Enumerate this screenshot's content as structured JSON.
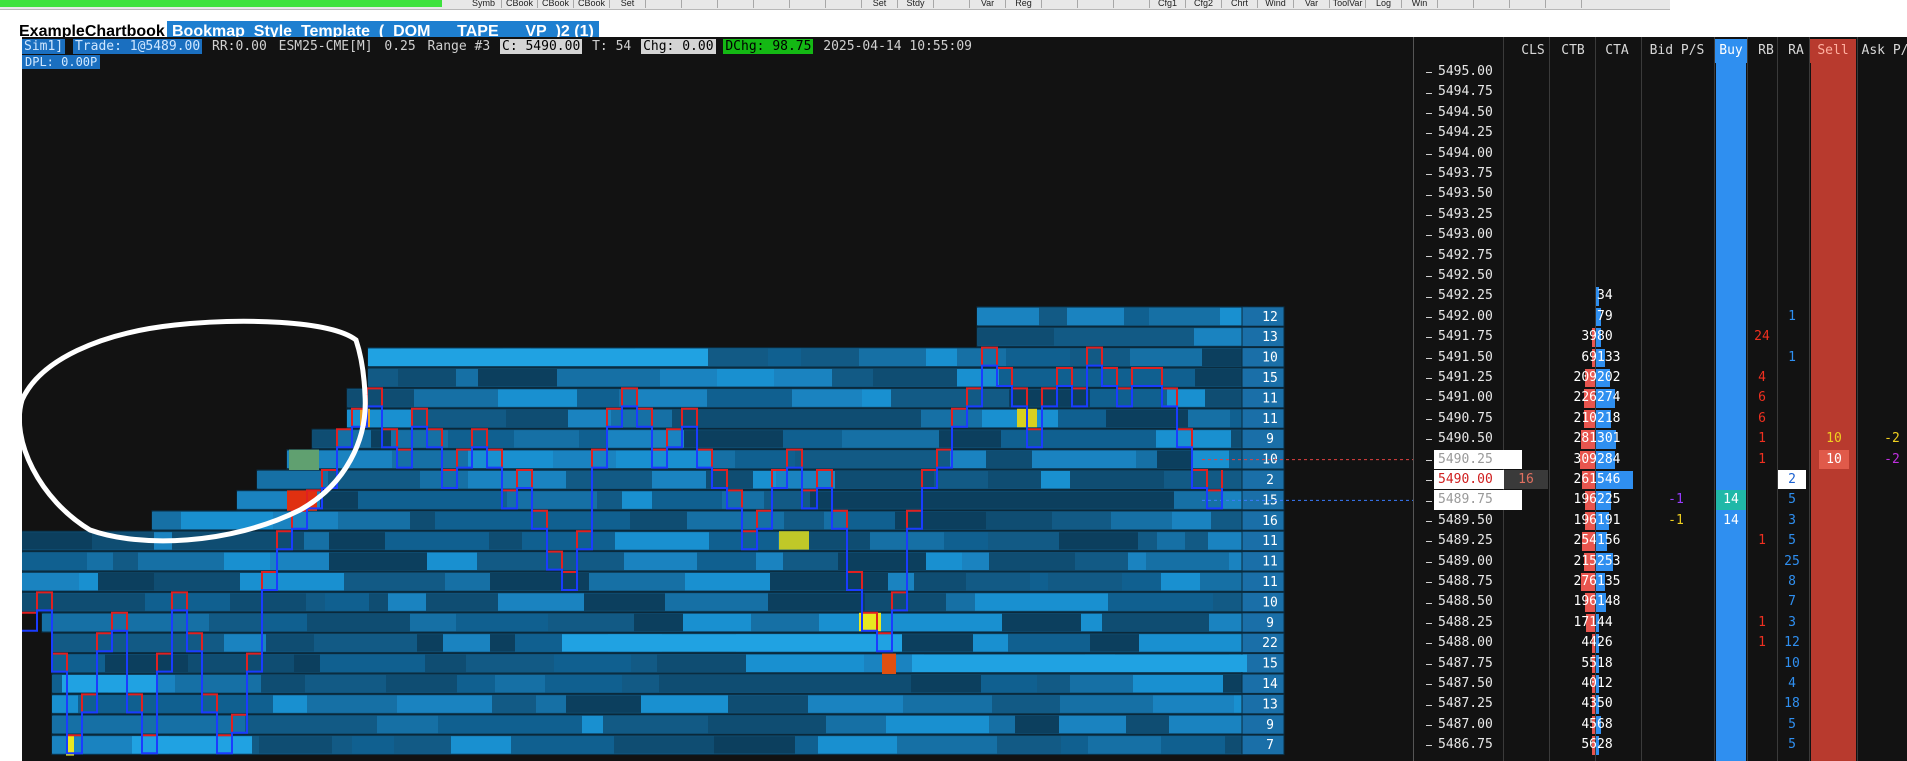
{
  "toolbar": {
    "buttons": [
      "Symb",
      "CBook",
      "CBook",
      "CBook",
      "Set",
      "",
      "",
      "",
      "",
      "",
      "",
      "Set",
      "Stdy",
      "",
      "Var",
      "Reg",
      "",
      "",
      "",
      "Cfg1",
      "Cfg2",
      "Chrt",
      "Wind",
      "Var",
      "ToolVar",
      "Log",
      "Win",
      "",
      "",
      "",
      ""
    ]
  },
  "tabs": [
    {
      "label": "ExampleChartbook"
    },
    {
      "label": "Bookmap_Style_Template_(_DOM___TAPE___VP_)2 (1)"
    }
  ],
  "infobar": {
    "sim": "Sim1]",
    "trade": "Trade: 1@5489.00",
    "rr": "RR:0.00",
    "symbol": "ESM25-CME[M]",
    "tick": "0.25",
    "range": "Range #3",
    "close": "C: 5490.00",
    "t": "T: 54",
    "chg": "Chg: 0.00",
    "dchg": "DChg: 98.75",
    "datetime": "2025-04-14 10:55:09",
    "dpl": "DPL: 0.00P"
  },
  "ladder": {
    "headers": {
      "cls": "CLS",
      "ctb": "CTB",
      "cta": "CTA",
      "bidps": "Bid P/S",
      "buy": "Buy",
      "rb": "RB",
      "ra": "RA",
      "sell": "Sell",
      "askps": "Ask P/"
    },
    "prices": [
      "5495.00",
      "5494.75",
      "5494.50",
      "5494.25",
      "5494.00",
      "5493.75",
      "5493.50",
      "5493.25",
      "5493.00",
      "5492.75",
      "5492.50",
      "5492.25",
      "5492.00",
      "5491.75",
      "5491.50",
      "5491.25",
      "5491.00",
      "5490.75",
      "5490.50",
      "5490.25",
      "5490.00",
      "5489.75",
      "5489.50",
      "5489.25",
      "5489.00",
      "5488.75",
      "5488.50",
      "5488.25",
      "5488.00",
      "5487.75",
      "5487.50",
      "5487.25",
      "5487.00",
      "5486.75"
    ],
    "current_price_index": 20,
    "ask_index": 19,
    "bid_index": 21,
    "cls_value": "16",
    "ctb": [
      "",
      "",
      "",
      "",
      "",
      "",
      "",
      "",
      "",
      "",
      "",
      "",
      "",
      "39",
      "69",
      "209",
      "226",
      "210",
      "281",
      "309",
      "261",
      "196",
      "196",
      "254",
      "215",
      "276",
      "196",
      "171",
      "44",
      "55",
      "40",
      "43",
      "45",
      "56"
    ],
    "cta": [
      "",
      "",
      "",
      "",
      "",
      "",
      "",
      "",
      "",
      "",
      "",
      "34",
      "79",
      "80",
      "133",
      "202",
      "274",
      "218",
      "301",
      "284",
      "546",
      "225",
      "191",
      "156",
      "253",
      "135",
      "148",
      "44",
      "26",
      "18",
      "12",
      "50",
      "68",
      "28"
    ],
    "bid_ps": [
      "",
      "",
      "",
      "",
      "",
      "",
      "",
      "",
      "",
      "",
      "",
      "",
      "",
      "",
      "",
      "",
      "",
      "",
      "",
      "",
      "",
      "-1",
      "-1",
      "",
      "",
      "",
      "",
      "",
      "",
      "",
      "",
      "",
      "",
      ""
    ],
    "buy": [
      "",
      "",
      "",
      "",
      "",
      "",
      "",
      "",
      "",
      "",
      "",
      "",
      "",
      "",
      "",
      "",
      "",
      "",
      "",
      "",
      "",
      "14",
      "14",
      "",
      "",
      "",
      "",
      "",
      "",
      "",
      "",
      "",
      "",
      ""
    ],
    "rb": [
      "",
      "",
      "",
      "",
      "",
      "",
      "",
      "",
      "",
      "",
      "",
      "",
      "",
      "24",
      "",
      "4",
      "6",
      "6",
      "1",
      "1",
      "",
      "",
      "",
      "1",
      "",
      "",
      "",
      "1",
      "1",
      "",
      "",
      "",
      "",
      ""
    ],
    "ra": [
      "",
      "",
      "",
      "",
      "",
      "",
      "",
      "",
      "",
      "",
      "",
      "",
      "1",
      "",
      "1",
      "",
      "",
      "",
      "",
      "",
      "2",
      "5",
      "3",
      "5",
      "25",
      "8",
      "7",
      "3",
      "12",
      "10",
      "4",
      "18",
      "5",
      "5"
    ],
    "sell": [
      "",
      "",
      "",
      "",
      "",
      "",
      "",
      "",
      "",
      "",
      "",
      "",
      "",
      "",
      "",
      "",
      "",
      "",
      "10",
      "10",
      "",
      "",
      "",
      "",
      "",
      "",
      "",
      "",
      "",
      "",
      "",
      "",
      "",
      ""
    ],
    "ask_ps": [
      "",
      "",
      "",
      "",
      "",
      "",
      "",
      "",
      "",
      "",
      "",
      "",
      "",
      "",
      "",
      "",
      "",
      "",
      "-2",
      "-2",
      "",
      "",
      "",
      "",
      "",
      "",
      "",
      "",
      "",
      "",
      "",
      "",
      "",
      ""
    ]
  },
  "heatmap_levels": [
    "12",
    "13",
    "10",
    "15",
    "11",
    "11",
    "9",
    "10",
    "2",
    "15",
    "16",
    "11",
    "11",
    "11",
    "10",
    "9",
    "22",
    "15",
    "14",
    "13",
    "9",
    "7"
  ],
  "colors": {
    "background": "#121212",
    "ctb_bar": "#e8554e",
    "cta_bar": "#2f8ff0",
    "buy_col": "#2f8ff0",
    "sell_col": "#b83a2e",
    "heat_dark": "#0e4a6e",
    "heat_mid": "#1680bf",
    "heat_bright": "#20a2e2",
    "bid_line": "#1a3cff",
    "ask_line": "#e02020"
  }
}
